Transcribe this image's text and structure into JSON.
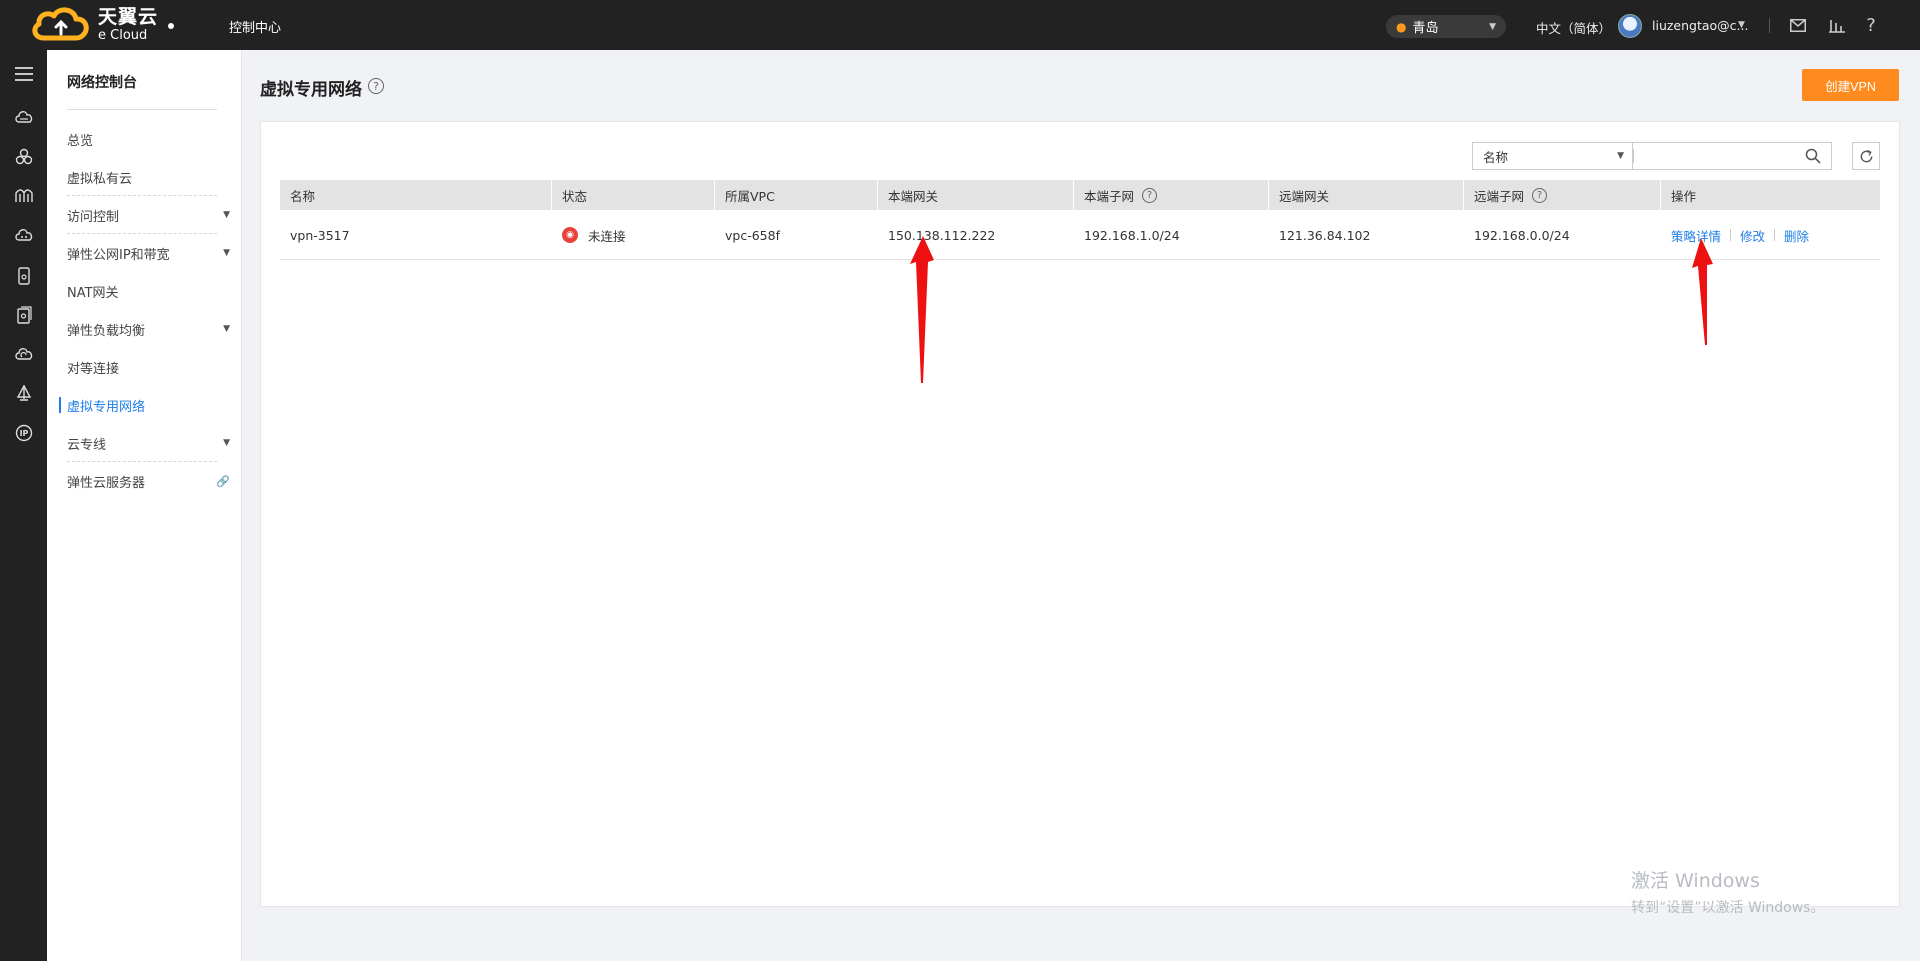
{
  "header": {
    "logo_cn": "天翼云",
    "logo_en": "e Cloud",
    "console": "控制中心",
    "region": "青岛",
    "language": "中文（简体）",
    "user": "liuzengtao@c...",
    "icons": [
      "mail-icon",
      "stats-icon",
      "help-icon"
    ]
  },
  "rail": {
    "icons": [
      "menu-icon",
      "cloud-host-icon",
      "network-icon",
      "bridge-icon",
      "cloud-db-icon",
      "storage-icon",
      "security-icon",
      "cloud-backup-icon",
      "sail-icon",
      "ip-icon"
    ]
  },
  "subnav": {
    "title": "网络控制台",
    "items": [
      {
        "label": "总览"
      },
      {
        "label": "虚拟私有云"
      },
      {
        "label": "访问控制"
      },
      {
        "label": "弹性公网IP和带宽"
      },
      {
        "label": "NAT网关"
      },
      {
        "label": "弹性负载均衡"
      },
      {
        "label": "对等连接"
      },
      {
        "label": "虚拟专用网络"
      },
      {
        "label": "云专线"
      },
      {
        "label": "弹性云服务器"
      }
    ]
  },
  "main": {
    "title": "虚拟专用网络",
    "create_button": "创建VPN",
    "filter": {
      "select_value": "名称",
      "search_value": ""
    },
    "table": {
      "columns": [
        "名称",
        "状态",
        "所属VPC",
        "本端网关",
        "本端子网",
        "远端网关",
        "远端子网",
        "操作"
      ],
      "rows": [
        {
          "name": "vpn-3517",
          "status": "未连接",
          "vpc": "vpc-658f",
          "local_gateway": "150.138.112.222",
          "local_subnet": "192.168.1.0/24",
          "remote_gateway": "121.36.84.102",
          "remote_subnet": "192.168.0.0/24",
          "actions": [
            "策略详情",
            "修改",
            "删除"
          ]
        }
      ]
    }
  },
  "watermark": {
    "line1": "激活 Windows",
    "line2": "转到“设置”以激活 Windows。"
  },
  "colors": {
    "accent": "#1e7ee8",
    "primary_button": "#ff8a1d",
    "status_disconnected": "#e8433a",
    "annotation_arrow": "#ee1111"
  }
}
